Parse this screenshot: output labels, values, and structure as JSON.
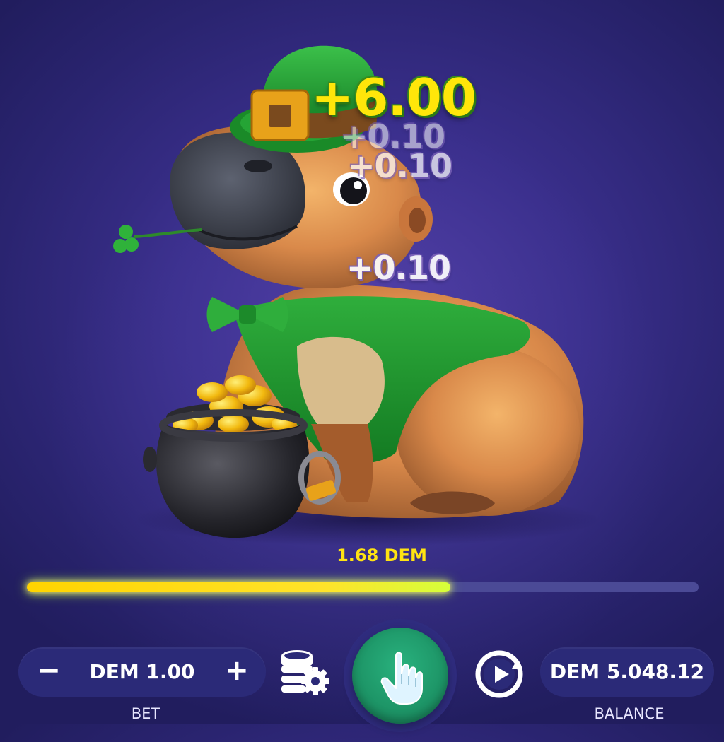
{
  "win": {
    "big_amount": "+6.00",
    "increments": [
      "+0.10",
      "+0.10",
      "+0.10"
    ]
  },
  "progress": {
    "value_label": "1.68 DEM",
    "fill_fraction": 0.63
  },
  "bet": {
    "minus_label": "−",
    "plus_label": "+",
    "value": "DEM 1.00",
    "label": "BET"
  },
  "balance": {
    "value": "DEM 5.048.12",
    "label": "BALANCE"
  },
  "icons": {
    "coin_settings": "coins-gear-icon",
    "play": "tap-hand-icon",
    "autoplay": "autoplay-icon"
  },
  "colors": {
    "background": "#3a2f8c",
    "accent_yellow": "#ffe312",
    "play_green": "#1d9466",
    "pill": "#2b2a78"
  }
}
